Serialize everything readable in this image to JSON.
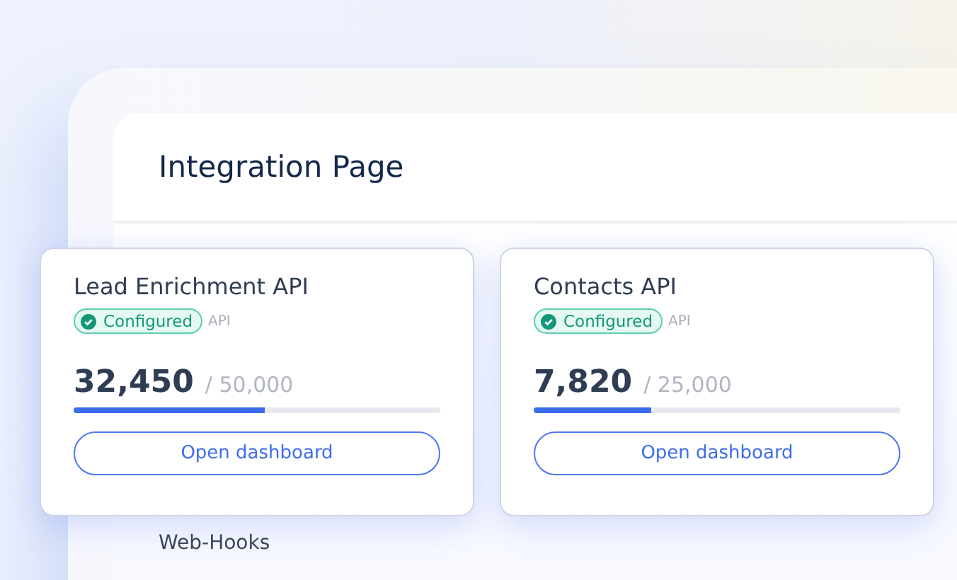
{
  "page": {
    "title": "Integration Page"
  },
  "cards": [
    {
      "title": "Lead Enrichment API",
      "status": {
        "label": "Configured",
        "configured": true
      },
      "type": "API",
      "usage": "32,450",
      "limit": "/ 50,000",
      "level": 0.52,
      "button": "Open dashboard"
    },
    {
      "title": "Contacts API",
      "status": {
        "label": "Configured",
        "configured": true
      },
      "type": "API",
      "usage": "7,820",
      "limit": "/ 25,000",
      "level": 0.32,
      "button": "Open dashboard"
    }
  ],
  "section": {
    "title": "Web-Hooks"
  }
}
